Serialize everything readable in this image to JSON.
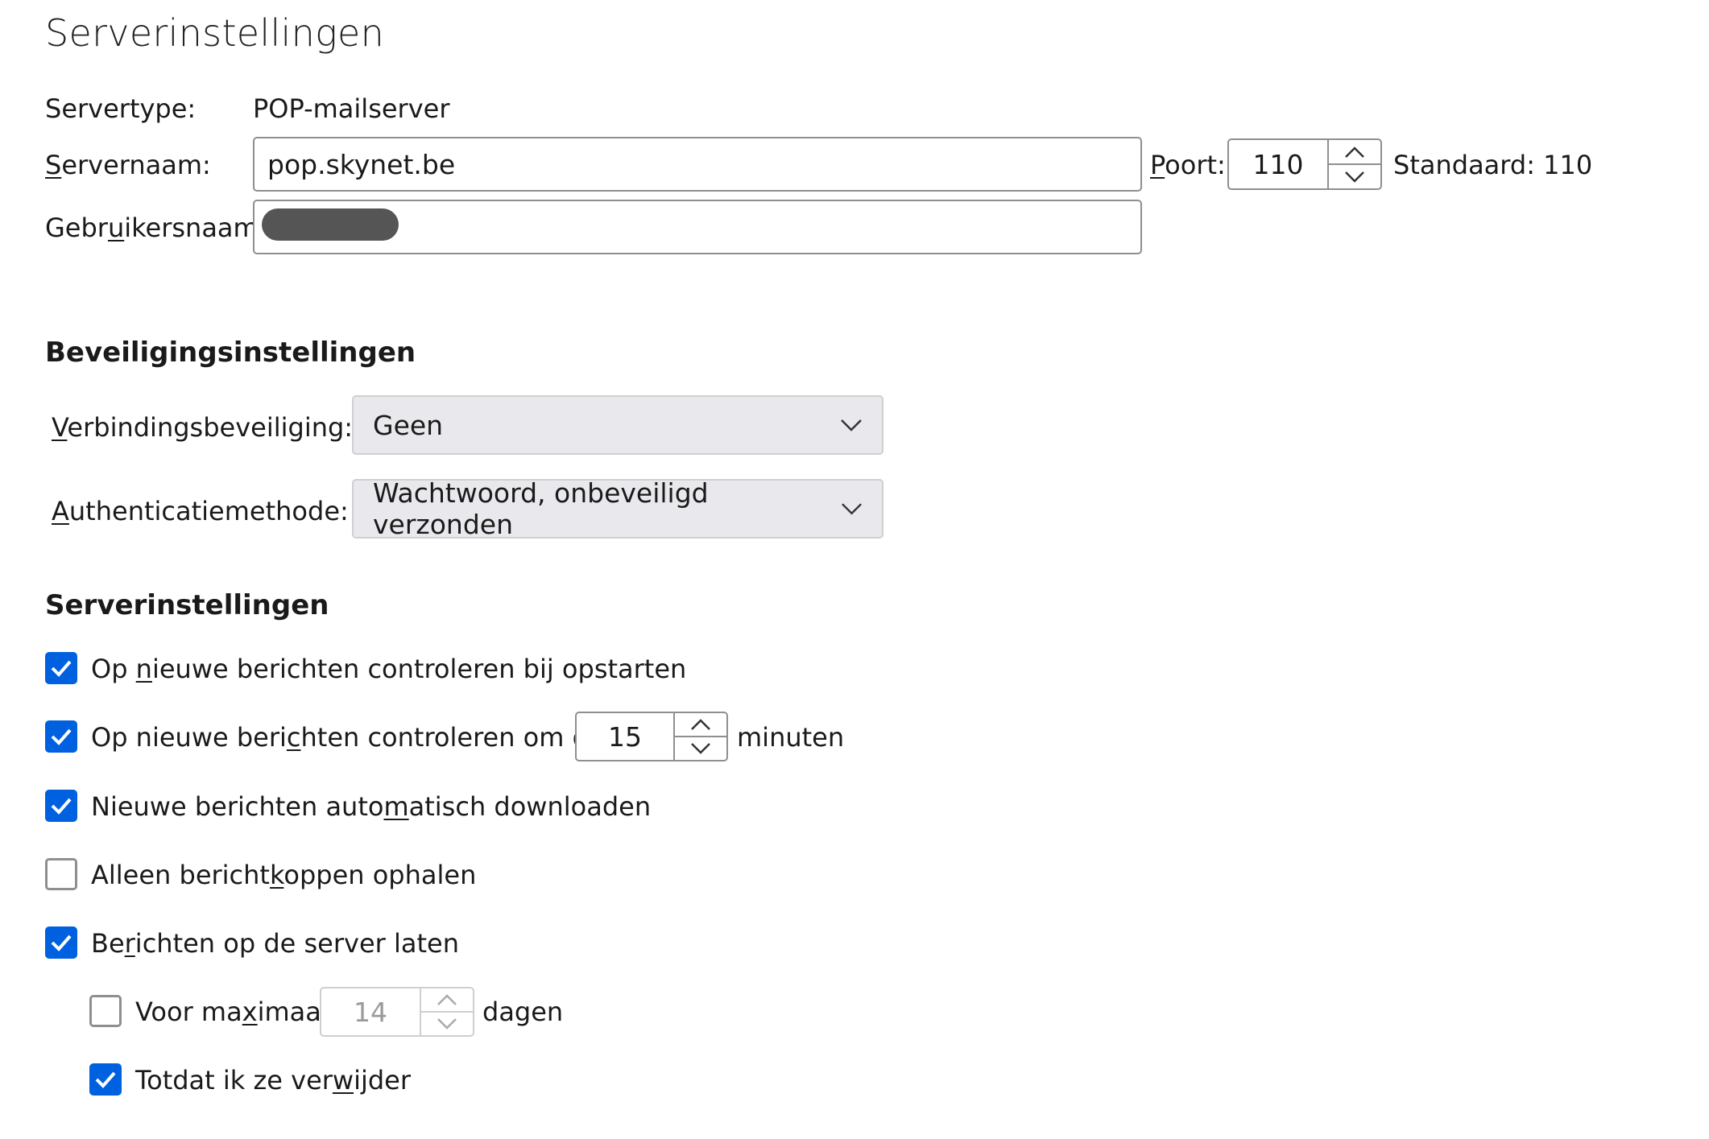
{
  "title": "Serverinstellingen",
  "server": {
    "type_label": "Servertype:",
    "type_value": "POP-mailserver",
    "name_label_pre": "",
    "name_label_key": "S",
    "name_label_post": "ervernaam:",
    "name_value": "pop.skynet.be",
    "port_label_key": "P",
    "port_label_post": "oort:",
    "port_value": "110",
    "default_label": "Standaard: 110",
    "user_label_pre": "Gebr",
    "user_label_key": "u",
    "user_label_post": "ikersnaam:",
    "user_value": ""
  },
  "security": {
    "heading": "Beveiligingsinstellingen",
    "conn_label_key": "V",
    "conn_label_post": "erbindingsbeveiliging:",
    "conn_value": "Geen",
    "auth_label_key": "A",
    "auth_label_post": "uthenticatiemethode:",
    "auth_value": "Wachtwoord, onbeveiligd verzonden"
  },
  "settings": {
    "heading": "Serverinstellingen",
    "check_startup": {
      "pre": "Op ",
      "key": "n",
      "post": "ieuwe berichten controleren bij opstarten",
      "checked": true
    },
    "check_interval": {
      "pre": "Op nieuwe beri",
      "key": "c",
      "post": "hten controleren om de",
      "checked": true,
      "value": "15",
      "unit": "minuten"
    },
    "auto_download": {
      "pre": "Nieuwe berichten auto",
      "key": "m",
      "post": "atisch downloaden",
      "checked": true
    },
    "headers_only": {
      "pre": "Alleen bericht",
      "key": "k",
      "post": "oppen ophalen",
      "checked": false
    },
    "leave_on_server": {
      "pre": "Be",
      "key": "r",
      "post": "ichten op de server laten",
      "checked": true
    },
    "max_days": {
      "pre": "Voor ma",
      "key": "x",
      "post": "imaal",
      "checked": false,
      "value": "14",
      "unit": "dagen"
    },
    "until_delete": {
      "pre": "Totdat ik ze ver",
      "key": "w",
      "post": "ijder",
      "checked": true
    }
  },
  "colors": {
    "accent": "#0061e0",
    "border": "#8f8f8f",
    "select_bg": "#e9e9ed"
  }
}
